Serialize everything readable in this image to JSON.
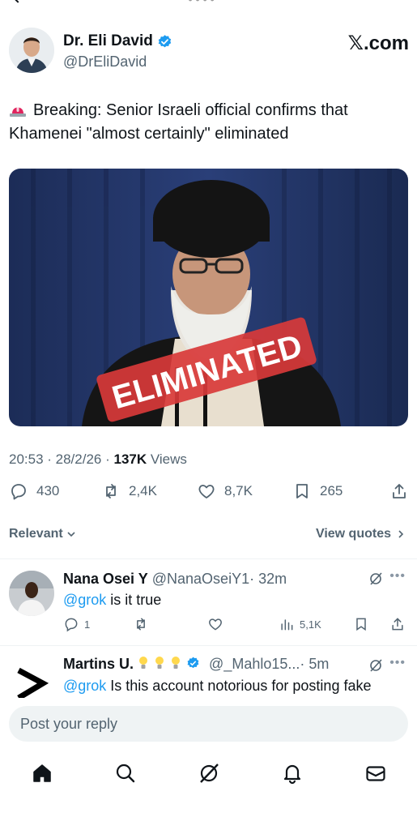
{
  "post": {
    "author_name": "Dr. Eli David",
    "author_handle": "@DrEliDavid",
    "brand": "𝕏.com",
    "text": "Breaking: Senior Israeli official confirms that Khamenei \"almost certainly\" eliminated",
    "media_overlay": "ELIMINATED",
    "time": "20:53 · 28/2/26 · ",
    "views_count": "137K",
    "views_label": " Views",
    "replies": "430",
    "reposts": "2,4K",
    "likes": "8,7K",
    "bookmarks": "265"
  },
  "sort": {
    "label": "Relevant",
    "view_quotes": "View quotes"
  },
  "replies": [
    {
      "name": "Nana Osei Y",
      "handle": "@NanaOseiY1",
      "time": "· 32m",
      "mention": "@grok",
      "text": " is it true",
      "reply_count": "1",
      "views": "5,1K"
    },
    {
      "name": "Martins U.",
      "handle": "@_Mahlo15...",
      "time": "· 5m",
      "mention": "@grok",
      "text": " Is this account notorious for posting fake"
    }
  ],
  "compose": {
    "placeholder": "Post your reply"
  },
  "icons": {
    "verified": "verified-badge-icon",
    "reply": "reply-icon",
    "repost": "repost-icon",
    "like": "heart-icon",
    "bookmark": "bookmark-icon",
    "share": "share-icon",
    "grok": "grok-icon",
    "more": "more-icon",
    "home": "home-icon",
    "search": "search-icon",
    "notifications": "bell-icon",
    "messages": "envelope-icon"
  },
  "colors": {
    "accent": "#1d9bf0",
    "text": "#0f1419",
    "muted": "#536471",
    "stamp_red": "#d83a3a"
  }
}
